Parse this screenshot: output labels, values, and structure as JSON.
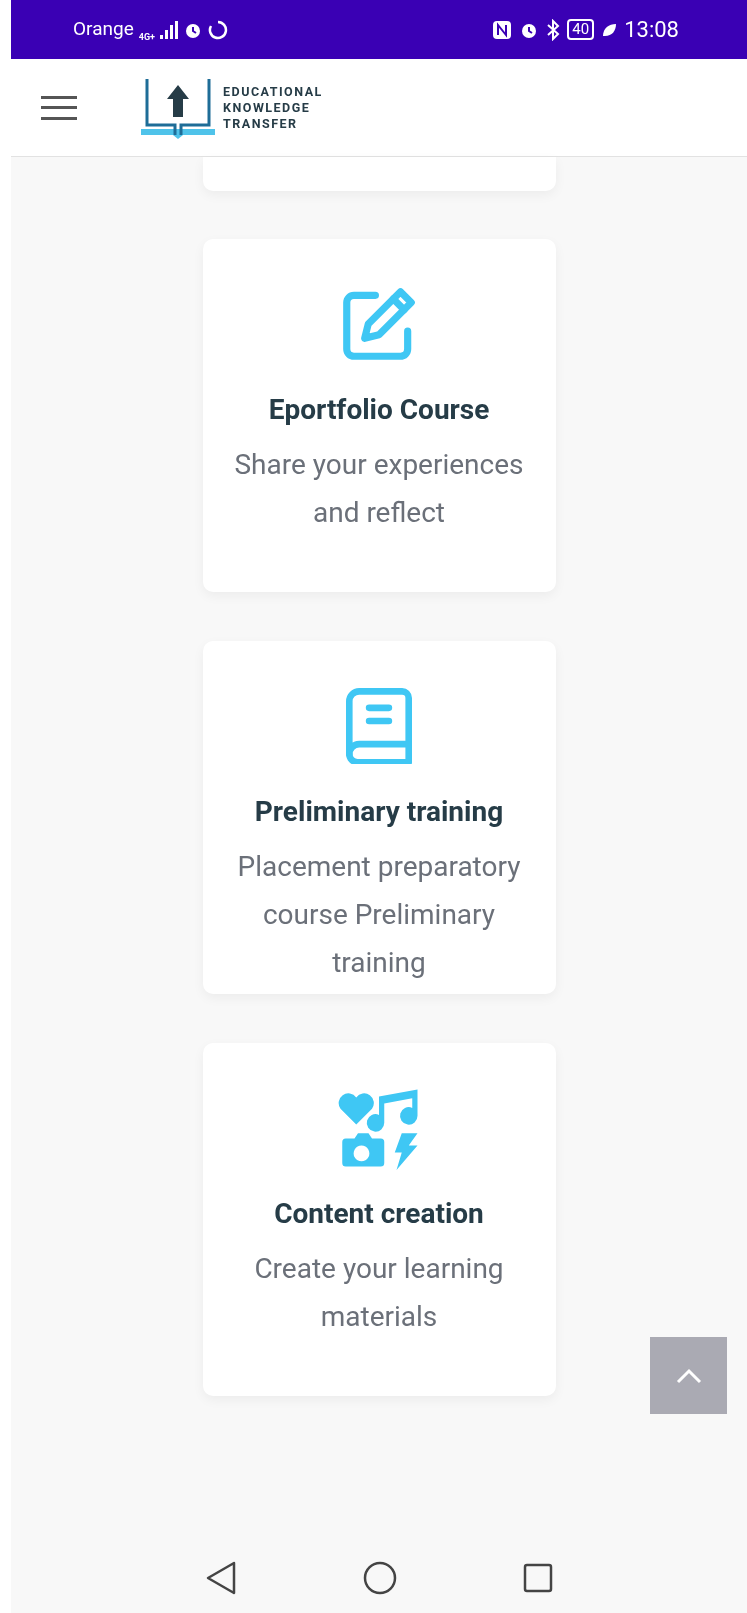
{
  "status_bar": {
    "carrier": "Orange",
    "network": "4G+",
    "battery": "40",
    "time": "13:08"
  },
  "header": {
    "logo_lines": [
      "EDUCATIONAL",
      "KNOWLEDGE",
      "TRANSFER"
    ]
  },
  "cards": [
    {
      "kind": "partial"
    },
    {
      "kind": "edit",
      "title": "Eportfolio Course",
      "description": "Share your experiences and reflect"
    },
    {
      "kind": "book",
      "title": "Preliminary training",
      "description": "Placement preparatory course Preliminary training"
    },
    {
      "kind": "media",
      "title": "Content creation",
      "description": "Create your learning materials"
    }
  ]
}
